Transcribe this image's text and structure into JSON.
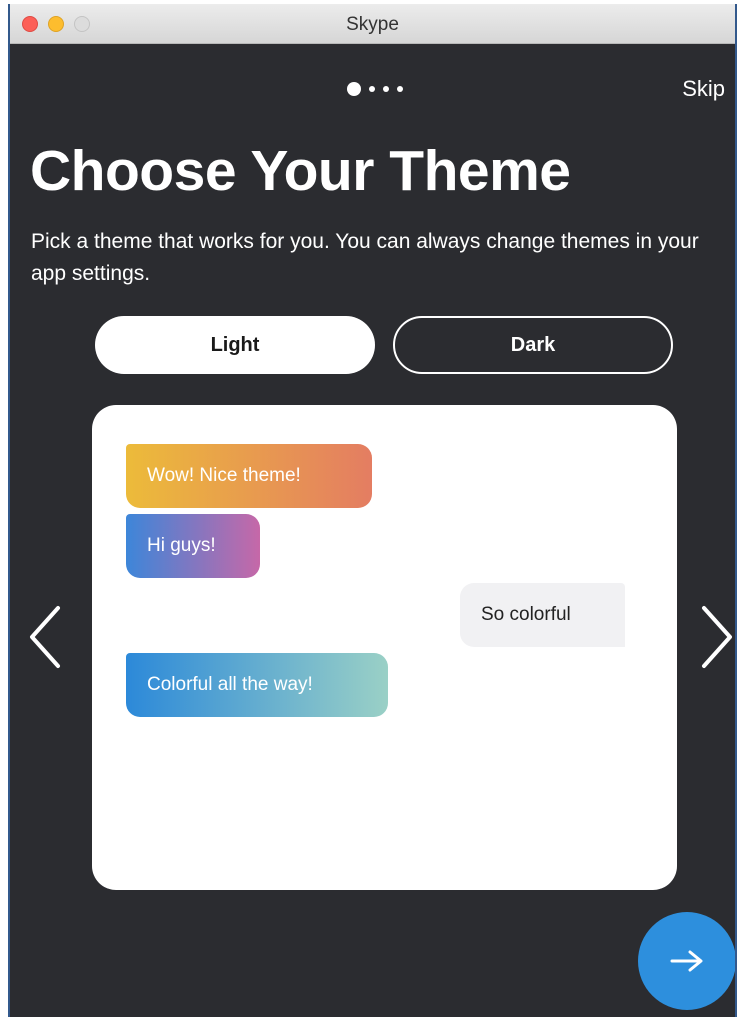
{
  "window": {
    "title": "Skype"
  },
  "onboarding": {
    "skip_label": "Skip",
    "page_indicator": {
      "current": 1,
      "total": 4
    },
    "heading": "Choose Your Theme",
    "subtitle": "Pick a theme that works for you. You can always change themes in your app settings.",
    "themes": [
      {
        "label": "Light",
        "selected": true
      },
      {
        "label": "Dark",
        "selected": false
      }
    ],
    "preview_messages": [
      {
        "text": "Wow! Nice theme!",
        "sender": "other"
      },
      {
        "text": "Hi guys!",
        "sender": "other"
      },
      {
        "text": "So colorful",
        "sender": "self"
      },
      {
        "text": "Colorful all the way!",
        "sender": "other"
      }
    ],
    "icons": {
      "prev": "chevron-left-icon",
      "next": "chevron-right-icon",
      "continue": "arrow-right-icon"
    }
  },
  "colors": {
    "background": "#2b2c30",
    "accent": "#2d8fdd"
  }
}
